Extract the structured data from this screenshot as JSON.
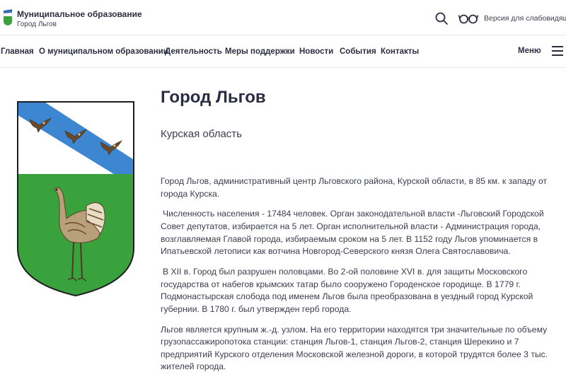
{
  "header": {
    "brand_title": "Муниципальное образование",
    "brand_subtitle": "Город Льгов",
    "accessibility_label": "Версия для слабовидящих"
  },
  "nav": {
    "items": [
      {
        "label": "Главная"
      },
      {
        "label": "О муниципальном образовании"
      },
      {
        "label": "Деятельность"
      },
      {
        "label": "Меры поддержки"
      },
      {
        "label": "Новости"
      },
      {
        "label": "События"
      },
      {
        "label": "Контакты"
      }
    ],
    "menu_label": "Меню"
  },
  "page": {
    "title": "Город Льгов",
    "region": "Курская область",
    "paragraphs": [
      "Город Льгов, административный центр Льговского района, Курской области, в 85 км. к западу от города Курска.",
      "Численность населения - 17484 человек. Орган законодательной власти -Льговский Городской Совет депутатов, избирается на 5 лет. Орган исполнительной власти - Администрация города, возглавляемая Главой города, избираемым сроком на 5 лет. В 1152 году Льгов упоминается в Ипатьевской летописи как вотчина Новгород-Северского князя Олега Святославовича.",
      "В XII в. Город был разрушен половцами. Во 2-ой половине XVI в. для защиты Московского государства от набегов крымских татар было сооружено Городенское городище. В 1779 г. Подмонастырская слобода под именем Льгов была преобразована в уездный город Курской губернии. В 1780 г. был утвержден герб города.",
      "Льгов является крупным ж.-д. узлом. На его территории находятся три значительные по объему грузопассажиропотока станции: станция Льгов-1, станция Льгов-2, станция Шерекино и 7 предприятий Курского отделения Московской железной дороги, в которой трудятся более 3 тыс. жителей города."
    ]
  },
  "colors": {
    "text_dark": "#2b2d42",
    "coat_blue": "#3d86d1",
    "coat_green": "#3aa23d",
    "coat_white": "#ffffff"
  }
}
